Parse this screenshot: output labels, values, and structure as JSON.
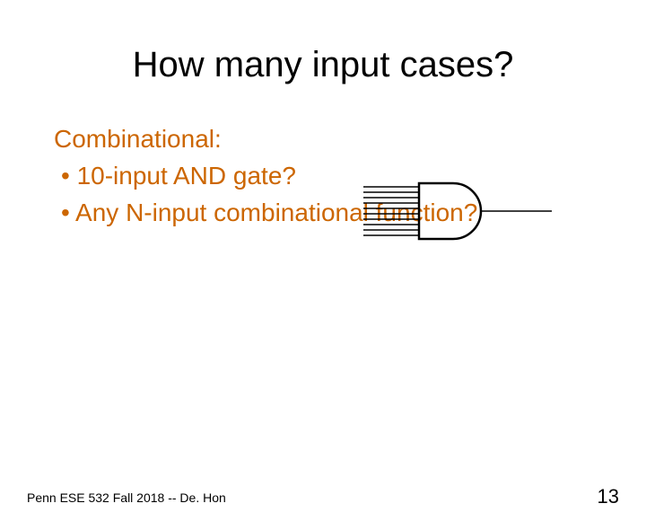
{
  "slide": {
    "title": "How many input cases?",
    "body": {
      "heading": "Combinational:",
      "bullet1": "• 10-input AND gate?",
      "bullet2": "• Any N-input combinational function?"
    },
    "footer": "Penn ESE 532 Fall 2018 -- De. Hon",
    "page_number": "13"
  },
  "colors": {
    "accent": "#cc6600",
    "text": "#000000"
  }
}
